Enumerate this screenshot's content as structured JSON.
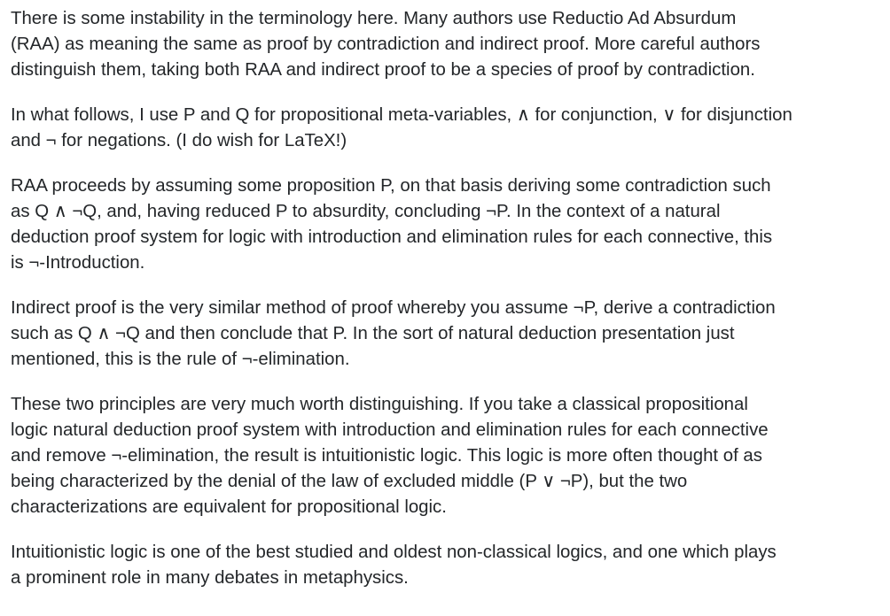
{
  "paragraphs": [
    {
      "lines": [
        "There is some instability in the terminology here. Many authors use Reductio Ad Absurdum",
        "(RAA) as meaning the same as proof by contradiction and indirect proof. More careful authors",
        "distinguish them, taking both RAA and indirect proof to be a species of proof by contradiction."
      ]
    },
    {
      "lines": [
        "In what follows, I use P and Q for propositional meta-variables, ∧ for conjunction, ∨ for disjunction",
        "and ¬ for negations. (I do wish for LaTeX!)"
      ]
    },
    {
      "lines": [
        "RAA proceeds by assuming some proposition P, on that basis deriving some contradiction such",
        "as Q ∧ ¬Q, and, having reduced P to absurdity, concluding ¬P. In the context of a natural",
        "deduction proof system for logic with introduction and elimination rules for each connective, this",
        "is ¬-Introduction."
      ]
    },
    {
      "lines": [
        "Indirect proof is the very similar method of proof whereby you assume ¬P, derive a contradiction",
        "such as Q ∧ ¬Q and then conclude that P. In the sort of natural deduction presentation just",
        "mentioned, this is the rule of ¬-elimination."
      ]
    },
    {
      "lines": [
        "These two principles are very much worth distinguishing. If you take a classical propositional",
        "logic natural deduction proof system with introduction and elimination rules for each connective",
        "and remove ¬-elimination, the result is intuitionistic logic. This logic is more often thought of as",
        "being characterized by the denial of the law of excluded middle (P ∨ ¬P), but the two",
        "characterizations are equivalent for propositional logic."
      ]
    },
    {
      "lines": [
        "Intuitionistic logic is one of the best studied and oldest non-classical logics, and one which plays",
        "a prominent role in many debates in metaphysics."
      ]
    }
  ]
}
